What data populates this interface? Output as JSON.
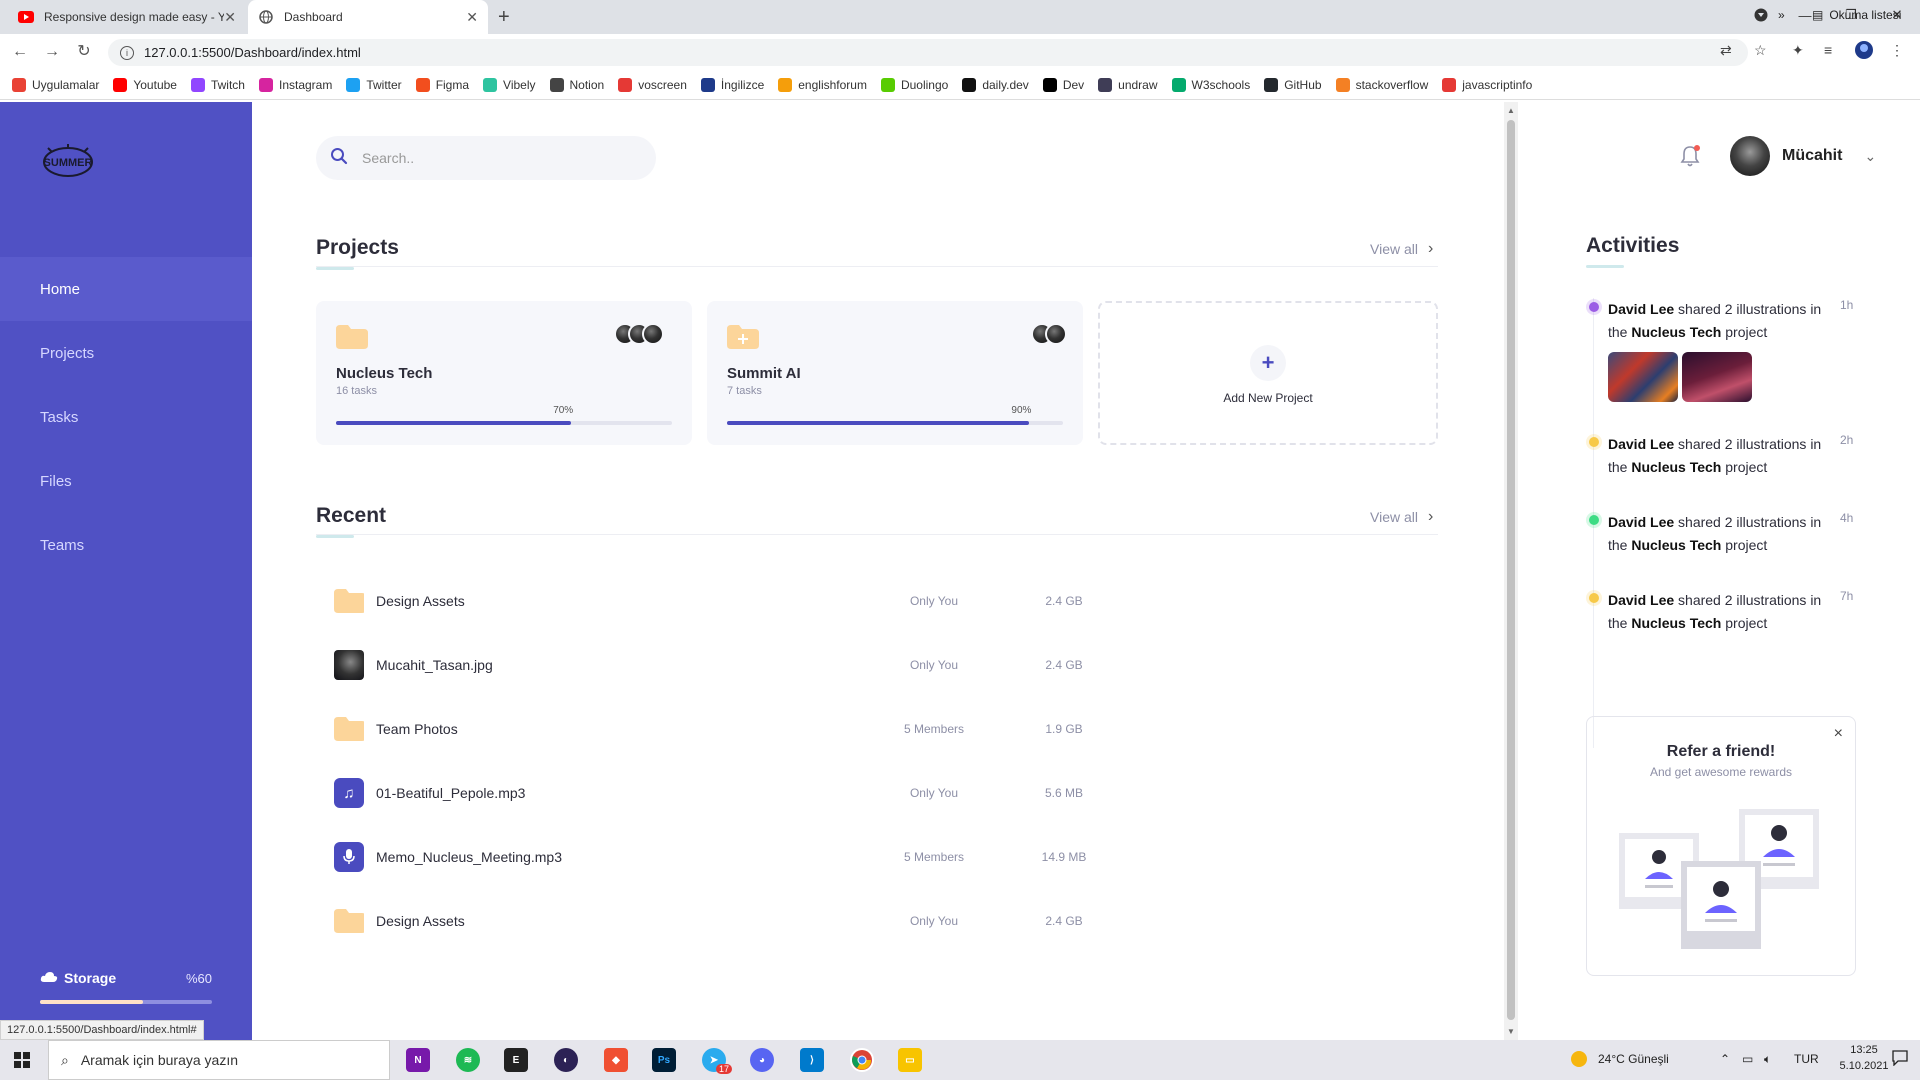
{
  "browser": {
    "tabs": [
      {
        "title": "Responsive design made easy - Y",
        "icon": "youtube-icon"
      },
      {
        "title": "Dashboard",
        "icon": "globe-icon"
      }
    ],
    "url": "127.0.0.1:5500/Dashboard/index.html",
    "status_url": "127.0.0.1:5500/Dashboard/index.html#",
    "bookmarks": [
      {
        "label": "Uygulamalar",
        "color": "#e94235"
      },
      {
        "label": "Youtube",
        "color": "#ff0000"
      },
      {
        "label": "Twitch",
        "color": "#9146ff"
      },
      {
        "label": "Instagram",
        "color": "#d6249f"
      },
      {
        "label": "Twitter",
        "color": "#1da1f2"
      },
      {
        "label": "Figma",
        "color": "#f24e1e"
      },
      {
        "label": "Vibely",
        "color": "#2ec4a0"
      },
      {
        "label": "Notion",
        "color": "#444444"
      },
      {
        "label": "voscreen",
        "color": "#e53935"
      },
      {
        "label": "İngilizce",
        "color": "#1e3a8a"
      },
      {
        "label": "englishforum",
        "color": "#f59e0b"
      },
      {
        "label": "Duolingo",
        "color": "#58cc02"
      },
      {
        "label": "daily.dev",
        "color": "#111111"
      },
      {
        "label": "Dev",
        "color": "#000000"
      },
      {
        "label": "undraw",
        "color": "#3f3d56"
      },
      {
        "label": "W3schools",
        "color": "#04aa6d"
      },
      {
        "label": "GitHub",
        "color": "#24292e"
      },
      {
        "label": "stackoverflow",
        "color": "#f48024"
      },
      {
        "label": "javascriptinfo",
        "color": "#e53935"
      }
    ],
    "bookmarks_more": "»",
    "reading_list": "Okuma listesi"
  },
  "sidebar": {
    "logo": "SUMMER",
    "items": [
      {
        "label": "Home",
        "active": true
      },
      {
        "label": "Projects",
        "active": false
      },
      {
        "label": "Tasks",
        "active": false
      },
      {
        "label": "Files",
        "active": false
      },
      {
        "label": "Teams",
        "active": false
      }
    ],
    "storage": {
      "label": "Storage",
      "percent_label": "%60",
      "fraction": 0.6
    }
  },
  "main": {
    "search_placeholder": "Search..",
    "projects_title": "Projects",
    "recent_title": "Recent",
    "view_all": "View all",
    "projects": [
      {
        "name": "Nucleus Tech",
        "tasks": "16 tasks",
        "progress_label": "70%",
        "progress": 0.7,
        "avatars": 3,
        "folder_icon": "folder-icon"
      },
      {
        "name": "Summit AI",
        "tasks": "7 tasks",
        "progress_label": "90%",
        "progress": 0.9,
        "avatars": 2,
        "folder_icon": "folder-plus-icon"
      }
    ],
    "add_project": "Add New Project",
    "recent": [
      {
        "name": "Design Assets",
        "share": "Only You",
        "size": "2.4 GB",
        "icon": "folder-icon"
      },
      {
        "name": "Mucahit_Tasan.jpg",
        "share": "Only You",
        "size": "2.4 GB",
        "icon": "image-thumbnail"
      },
      {
        "name": "Team Photos",
        "share": "5 Members",
        "size": "1.9 GB",
        "icon": "folder-icon"
      },
      {
        "name": "01-Beatiful_Pepole.mp3",
        "share": "Only You",
        "size": "5.6 MB",
        "icon": "music-icon"
      },
      {
        "name": "Memo_Nucleus_Meeting.mp3",
        "share": "5 Members",
        "size": "14.9 MB",
        "icon": "microphone-icon"
      },
      {
        "name": "Design Assets",
        "share": "Only You",
        "size": "2.4 GB",
        "icon": "folder-icon"
      }
    ]
  },
  "right": {
    "user": {
      "name": "Mücahit"
    },
    "activities_title": "Activities",
    "activities": [
      {
        "name": "David Lee",
        "text": " shared 2 illustrations in the ",
        "project": "Nucleus Tech",
        "suffix": " project",
        "time": "1h",
        "color": "#9b5de5",
        "has_images": true
      },
      {
        "name": "David Lee",
        "text": " shared 2 illustrations in the ",
        "project": "Nucleus Tech",
        "suffix": " project",
        "time": "2h",
        "color": "#f7c948",
        "has_images": false
      },
      {
        "name": "David Lee",
        "text": " shared 2 illustrations in the ",
        "project": "Nucleus Tech",
        "suffix": " project",
        "time": "4h",
        "color": "#3ddc84",
        "has_images": false
      },
      {
        "name": "David Lee",
        "text": " shared 2 illustrations in the ",
        "project": "Nucleus Tech",
        "suffix": " project",
        "time": "7h",
        "color": "#f7c948",
        "has_images": false
      }
    ],
    "refer": {
      "title": "Refer a friend!",
      "subtitle": "And get awesome rewards",
      "close": "×"
    }
  },
  "taskbar": {
    "search_placeholder": "Aramak için buraya yazın",
    "weather": "24°C  Güneşli",
    "lang": "TUR",
    "time": "13:25",
    "date": "5.10.2021",
    "telegram_badge": "17"
  }
}
